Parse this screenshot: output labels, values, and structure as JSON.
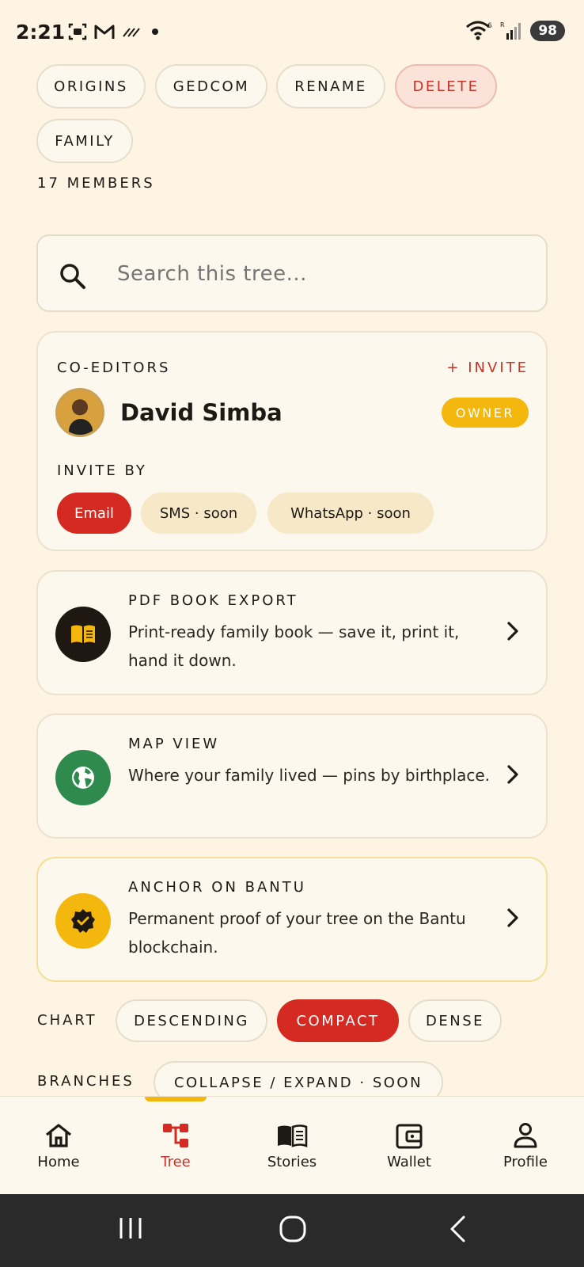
{
  "status_bar": {
    "time": "2:21",
    "battery": "98"
  },
  "actions": {
    "origins": "ORIGINS",
    "gedcom": "GEDCOM",
    "rename": "RENAME",
    "delete": "DELETE",
    "family": "FAMILY"
  },
  "members_count": "17 MEMBERS",
  "search": {
    "placeholder": "Search this tree..."
  },
  "co_editors": {
    "title": "CO-EDITORS",
    "invite_link": "+ INVITE",
    "owner_name": "David Simba",
    "owner_badge": "OWNER",
    "invite_by_label": "INVITE BY",
    "methods": [
      "Email",
      "SMS · soon",
      "WhatsApp · soon"
    ]
  },
  "features": [
    {
      "title": "PDF BOOK EXPORT",
      "desc": "Print-ready family book — save it, print it, hand it down.",
      "icon": "book-icon",
      "color": "#1f1712"
    },
    {
      "title": "MAP VIEW",
      "desc": "Where your family lived — pins by birthplace.",
      "icon": "globe-icon",
      "color": "#2e8b4d"
    },
    {
      "title": "ANCHOR ON BANTU",
      "desc": "Permanent proof of your tree on the Bantu blockchain.",
      "icon": "verified-badge-icon",
      "color": "#f4b70d"
    }
  ],
  "chart": {
    "label": "CHART",
    "options": [
      "DESCENDING",
      "COMPACT",
      "DENSE"
    ],
    "selected": "COMPACT"
  },
  "branches": {
    "label": "BRANCHES",
    "option": "COLLAPSE / EXPAND · SOON"
  },
  "nav": {
    "items": [
      "Home",
      "Tree",
      "Stories",
      "Wallet",
      "Profile"
    ],
    "active": "Tree"
  },
  "colors": {
    "accent": "#d52a22",
    "gold": "#f4b70d",
    "background": "#fdf4e3"
  }
}
